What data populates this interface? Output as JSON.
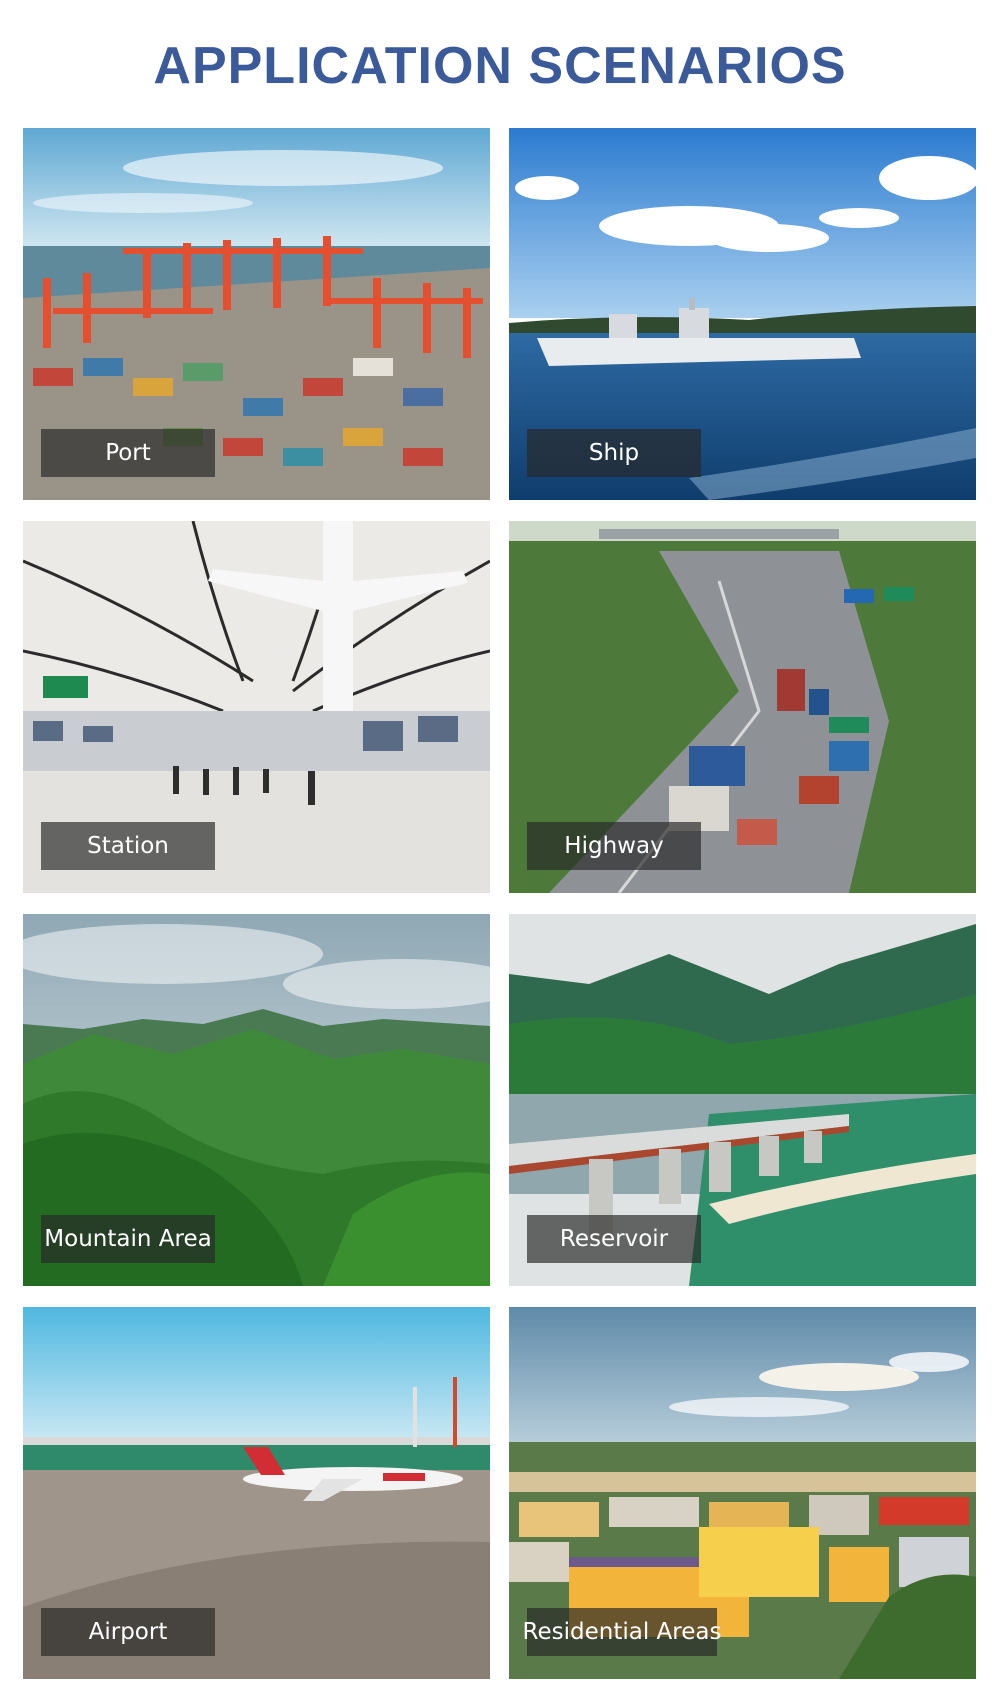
{
  "heading": "APPLICATION SCENARIOS",
  "scenarios": [
    {
      "label": "Port",
      "icon": "port-photo"
    },
    {
      "label": "Ship",
      "icon": "ship-photo"
    },
    {
      "label": "Station",
      "icon": "station-photo"
    },
    {
      "label": "Highway",
      "icon": "highway-photo"
    },
    {
      "label": "Mountain Area",
      "icon": "mountain-photo"
    },
    {
      "label": "Reservoir",
      "icon": "reservoir-photo"
    },
    {
      "label": "Airport",
      "icon": "airport-photo"
    },
    {
      "label": "Residential Areas",
      "icon": "residential-photo"
    }
  ],
  "colors": {
    "heading": "#3b5a9a",
    "label_bg": "#282828",
    "label_text": "#ffffff"
  }
}
